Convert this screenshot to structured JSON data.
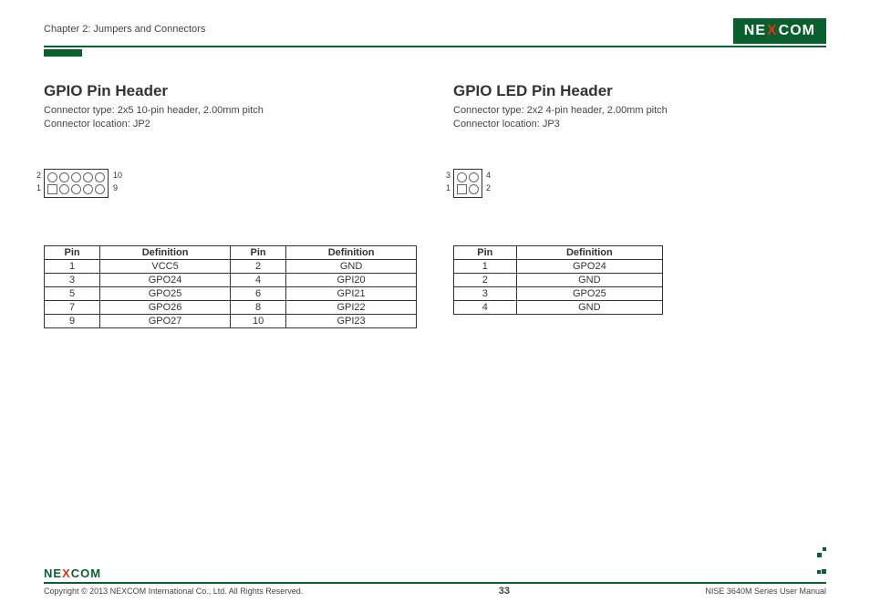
{
  "brand": {
    "pre": "NE",
    "x": "X",
    "post": "COM"
  },
  "chapterTitle": "Chapter 2: Jumpers and Connectors",
  "left": {
    "title": "GPIO Pin Header",
    "connType": "Connector type: 2x5 10-pin header, 2.00mm pitch",
    "connLoc": "Connector location: JP2",
    "diagram": {
      "topLeft": "2",
      "topRight": "10",
      "botLeft": "1",
      "botRight": "9",
      "cols": 5
    },
    "headers": [
      "Pin",
      "Definition",
      "Pin",
      "Definition"
    ],
    "rows": [
      [
        "1",
        "VCC5",
        "2",
        "GND"
      ],
      [
        "3",
        "GPO24",
        "4",
        "GPI20"
      ],
      [
        "5",
        "GPO25",
        "6",
        "GPI21"
      ],
      [
        "7",
        "GPO26",
        "8",
        "GPI22"
      ],
      [
        "9",
        "GPO27",
        "10",
        "GPI23"
      ]
    ]
  },
  "right": {
    "title": "GPIO LED Pin Header",
    "connType": "Connector type: 2x2 4-pin header, 2.00mm pitch",
    "connLoc": "Connector location: JP3",
    "diagram": {
      "topLeft": "3",
      "topRight": "4",
      "botLeft": "1",
      "botRight": "2",
      "cols": 2
    },
    "headers": [
      "Pin",
      "Definition"
    ],
    "rows": [
      [
        "1",
        "GPO24"
      ],
      [
        "2",
        "GND"
      ],
      [
        "3",
        "GPO25"
      ],
      [
        "4",
        "GND"
      ]
    ]
  },
  "footer": {
    "copyright": "Copyright © 2013 NEXCOM International Co., Ltd. All Rights Reserved.",
    "pageNumber": "33",
    "manual": "NISE 3640M Series User Manual"
  }
}
